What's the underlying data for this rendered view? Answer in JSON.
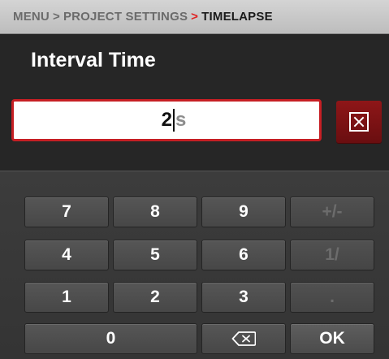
{
  "breadcrumb": {
    "items": [
      "MENU",
      "PROJECT SETTINGS",
      "TIMELAPSE"
    ],
    "separators": [
      ">",
      ">"
    ]
  },
  "title": "Interval Time",
  "input": {
    "value": "2",
    "unit": "s"
  },
  "keypad": {
    "keys": [
      {
        "label": "7",
        "enabled": true
      },
      {
        "label": "8",
        "enabled": true
      },
      {
        "label": "9",
        "enabled": true
      },
      {
        "label": "+/-",
        "enabled": false
      },
      {
        "label": "4",
        "enabled": true
      },
      {
        "label": "5",
        "enabled": true
      },
      {
        "label": "6",
        "enabled": true
      },
      {
        "label": "1/",
        "enabled": false
      },
      {
        "label": "1",
        "enabled": true
      },
      {
        "label": "2",
        "enabled": true
      },
      {
        "label": "3",
        "enabled": true
      },
      {
        "label": ".",
        "enabled": false
      },
      {
        "label": "0",
        "enabled": true
      },
      {
        "label": "OK",
        "enabled": true
      }
    ],
    "backspace_icon": "backspace-icon"
  },
  "icons": {
    "clear": "clear-x-icon",
    "backspace": "backspace-icon"
  },
  "colors": {
    "accent_red": "#c61f24",
    "clear_button": "#8e1618",
    "breadcrumb_bg": "#cfcfcf",
    "panel_bg": "#262626",
    "keypad_bg": "#3a3a3a",
    "key_bg": "#505050"
  }
}
